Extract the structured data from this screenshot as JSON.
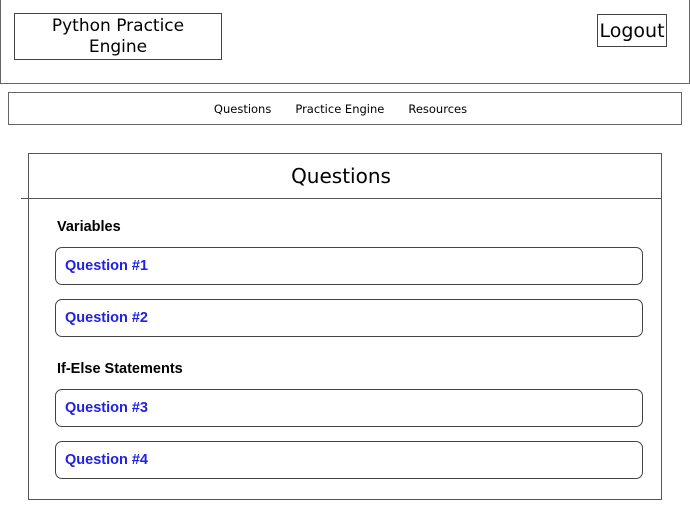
{
  "header": {
    "app_title": "Python Practice Engine",
    "logout_label": "Logout"
  },
  "nav": {
    "items": [
      "Questions",
      "Practice Engine",
      "Resources"
    ]
  },
  "panel": {
    "title": "Questions",
    "sections": [
      {
        "title": "Variables",
        "questions": [
          "Question #1",
          "Question #2"
        ]
      },
      {
        "title": "If-Else Statements",
        "questions": [
          "Question #3",
          "Question #4"
        ]
      }
    ]
  },
  "colors": {
    "link": "#1f1fe6",
    "border": "#555555"
  }
}
